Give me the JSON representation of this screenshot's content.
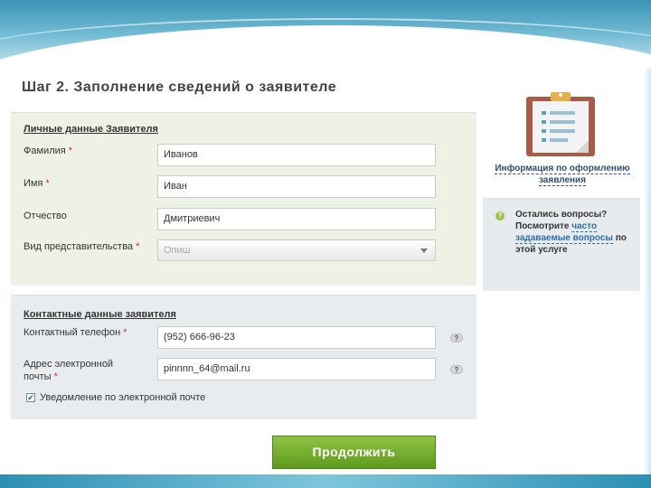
{
  "page": {
    "title": "Шаг 2. Заполнение сведений о заявителе"
  },
  "personal": {
    "header": "Личные данные Заявителя",
    "fields": [
      {
        "label": "Фамилия",
        "required": "*",
        "value": "Иванов"
      },
      {
        "label": "Имя",
        "required": "*",
        "value": "Иван"
      },
      {
        "label": "Отчество",
        "required": "",
        "value": "Дмитриевич"
      },
      {
        "label": "Вид представительства",
        "required": "*",
        "value": "Опиш"
      }
    ]
  },
  "contact": {
    "header": "Контактные данные заявителя",
    "phone_label": "Контактный телефон",
    "phone_required": "*",
    "phone_value": "(952) 666-96-23",
    "email_label": "Адрес электронной почты",
    "email_required": "*",
    "email_value": "pinnnn_64@mail.ru",
    "help_symbol": "?",
    "email_notify_checked": true,
    "email_notify_label": "Уведомление по электронной почте"
  },
  "actions": {
    "continue_label": "Продолжить"
  },
  "sidebar": {
    "info_link": "Информация по оформлению заявления",
    "faq_icon": "?",
    "faq_prefix": "Остались вопросы? Посмотрите",
    "faq_link": "часто задаваемые вопросы",
    "faq_suffix": "по этой услуге"
  },
  "colors": {
    "accent_green": "#6fab2b",
    "personal_panel_bg": "#eef2e4",
    "contact_panel_bg": "#e9ecee",
    "link_blue": "#2f6ea8"
  },
  "icons": [
    "clipboard-icon",
    "question-icon",
    "checkbox-check-icon",
    "dropdown-arrow-icon"
  ]
}
